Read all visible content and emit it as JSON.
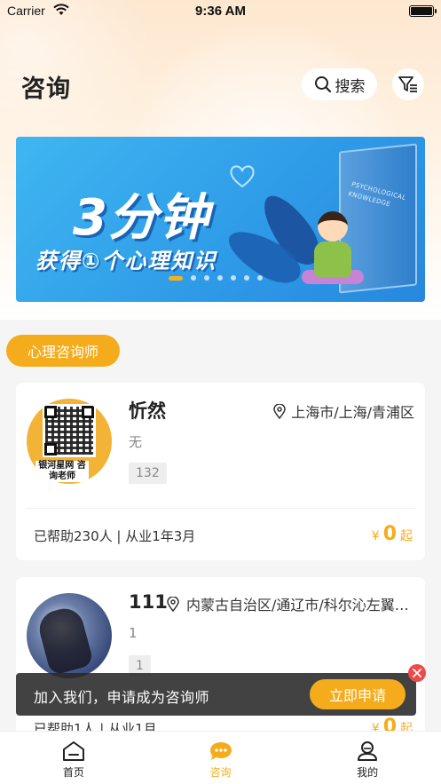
{
  "status_bar": {
    "carrier": "Carrier",
    "time": "9:36 AM"
  },
  "header": {
    "title": "咨询",
    "search_label": "搜索"
  },
  "banner": {
    "title": "3分钟",
    "subtitle": "获得①个心理知识",
    "book_text": "PSYCHOLOGICAL KNOWLEDGE",
    "page_count": 7,
    "active_page": 1
  },
  "section": {
    "tag": "心理咨询师"
  },
  "counselors": [
    {
      "name": "忻然",
      "location": "上海市/上海/青浦区",
      "description": "无",
      "tag": "132",
      "avatar_label": "银河星网 咨询老师",
      "stats": "已帮助230人 | 从业1年3月",
      "currency": "¥",
      "price": "0",
      "price_suffix": "起"
    },
    {
      "name": "111",
      "location": "内蒙古自治区/通辽市/科尔沁左翼…",
      "description": "1",
      "tag": "1",
      "stats": "已帮助1人 | 从业1月",
      "currency": "¥",
      "price": "0",
      "price_suffix": "起"
    }
  ],
  "join_bar": {
    "text": "加入我们，申请成为咨询师",
    "button": "立即申请"
  },
  "tabbar": {
    "tabs": [
      {
        "label": "首页",
        "icon": "home-icon"
      },
      {
        "label": "咨询",
        "icon": "chat-icon"
      },
      {
        "label": "我的",
        "icon": "profile-icon"
      }
    ],
    "active": 1
  },
  "colors": {
    "accent": "#f5ac1c",
    "banner_blue": "#2f9ce8",
    "close_red": "#ef4a4a"
  }
}
